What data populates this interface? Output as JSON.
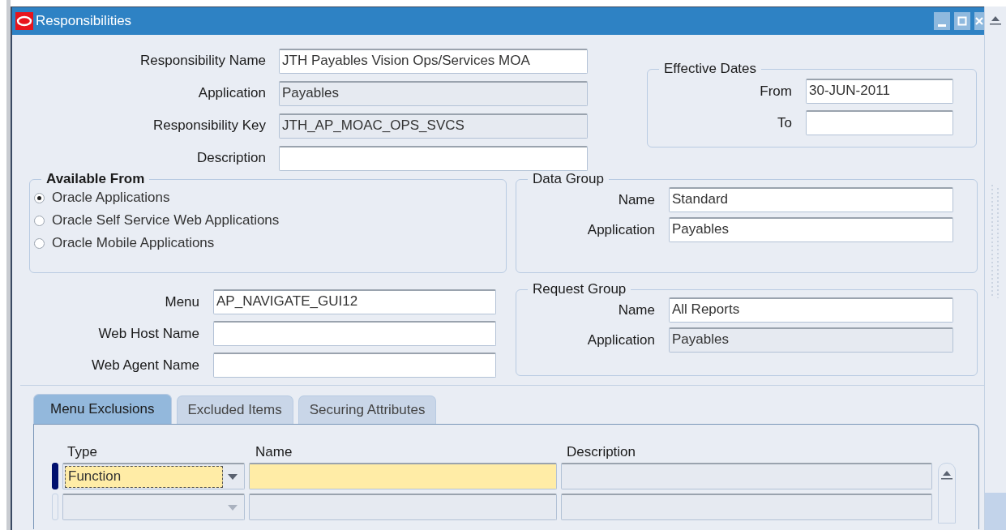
{
  "window": {
    "title": "Responsibilities"
  },
  "main_fields": [
    {
      "label": "Responsibility Name",
      "value": "JTH Payables Vision Ops/Services MOA",
      "readonly": false
    },
    {
      "label": "Application",
      "value": "Payables",
      "readonly": true
    },
    {
      "label": "Responsibility Key",
      "value": "JTH_AP_MOAC_OPS_SVCS",
      "readonly": true
    },
    {
      "label": "Description",
      "readonly": false
    }
  ],
  "effective_dates": {
    "title": "Effective Dates",
    "fields": [
      {
        "label": "From",
        "value": "30-JUN-2011",
        "readonly": false
      },
      {
        "label": "To",
        "readonly": false
      }
    ]
  },
  "available_from": {
    "title": "Available From",
    "options": [
      {
        "label": "Oracle Applications",
        "selected": true
      },
      {
        "label": "Oracle Self Service Web Applications",
        "selected": false
      },
      {
        "label": "Oracle Mobile Applications",
        "selected": false
      }
    ]
  },
  "data_group": {
    "title": "Data Group",
    "fields": [
      {
        "label": "Name",
        "value": "Standard",
        "readonly": false
      },
      {
        "label": "Application",
        "value": "Payables",
        "readonly": false
      }
    ]
  },
  "menu_fields": [
    {
      "label": "Menu",
      "value": "AP_NAVIGATE_GUI12",
      "readonly": false
    },
    {
      "label": "Web Host Name",
      "readonly": false
    },
    {
      "label": "Web Agent Name",
      "readonly": false
    }
  ],
  "request_group": {
    "title": "Request Group",
    "fields": [
      {
        "label": "Name",
        "value": "All Reports",
        "readonly": false
      },
      {
        "label": "Application",
        "value": "Payables",
        "readonly": true
      }
    ]
  },
  "tabs": [
    {
      "label": "Menu Exclusions",
      "selected": true
    },
    {
      "label": "Excluded Items",
      "selected": false
    },
    {
      "label": "Securing Attributes",
      "selected": false
    }
  ],
  "table": {
    "columns": [
      "Type",
      "Name",
      "Description"
    ],
    "rows": [
      {
        "current": true,
        "type": "Function"
      },
      {
        "current": false
      }
    ]
  }
}
